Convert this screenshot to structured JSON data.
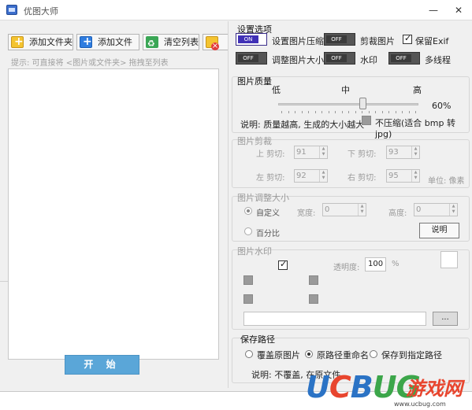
{
  "window": {
    "title": "优图大师",
    "minimize": "—",
    "close": "✕"
  },
  "toolbar": {
    "add_folder": "添加文件夹",
    "add_file": "添加文件",
    "clear_list": "清空列表"
  },
  "hint": "提示: 可直接将 <图片或文件夹> 拖拽至列表",
  "start_button": "开 始",
  "settings": {
    "title": "设置选项",
    "toggle_on_text": "ON",
    "toggle_off_text": "OFF",
    "compress": {
      "label": "设置图片压缩",
      "state": "on"
    },
    "crop": {
      "label": "剪裁图片",
      "state": "off"
    },
    "keep_exif": {
      "label": "保留Exif",
      "checked": true
    },
    "resize": {
      "label": "调整图片大小",
      "state": "off"
    },
    "watermark": {
      "label": "水印",
      "state": "off"
    },
    "multithread": {
      "label": "多线程",
      "state": "off"
    }
  },
  "quality": {
    "title": "图片质量",
    "low": "低",
    "mid": "中",
    "high": "高",
    "value": 60,
    "value_text": "60%",
    "note": "说明: 质量越高, 生成的大小越大",
    "no_compress_label": "不压缩(适合 bmp 转 jpg)"
  },
  "crop_section": {
    "title": "图片剪裁",
    "top_label": "上 剪切:",
    "top_value": "91",
    "bottom_label": "下 剪切:",
    "bottom_value": "93",
    "left_label": "左 剪切:",
    "left_value": "92",
    "right_label": "右 剪切:",
    "right_value": "95",
    "unit": "单位: 像素"
  },
  "resize_section": {
    "title": "图片调整大小",
    "custom_label": "自定义",
    "width_label": "宽度:",
    "width_value": "0",
    "height_label": "高度:",
    "height_value": "0",
    "percent_label": "百分比",
    "help_button": "说明"
  },
  "watermark_section": {
    "title": "图片水印",
    "opacity_label": "透明度:",
    "opacity_value": "100",
    "opacity_unit": "%",
    "browse_button": "..."
  },
  "save_section": {
    "title": "保存路径",
    "overwrite": "覆盖原图片",
    "rename": "原路径重命名",
    "save_to": "保存到指定路径",
    "note": "说明: 不覆盖, 在原文件..."
  },
  "watermark_logo": {
    "u": "U",
    "c": "C",
    "b": "B",
    "ug": "UG",
    "game": "游戏网",
    "url": "www.ucbug.com"
  }
}
